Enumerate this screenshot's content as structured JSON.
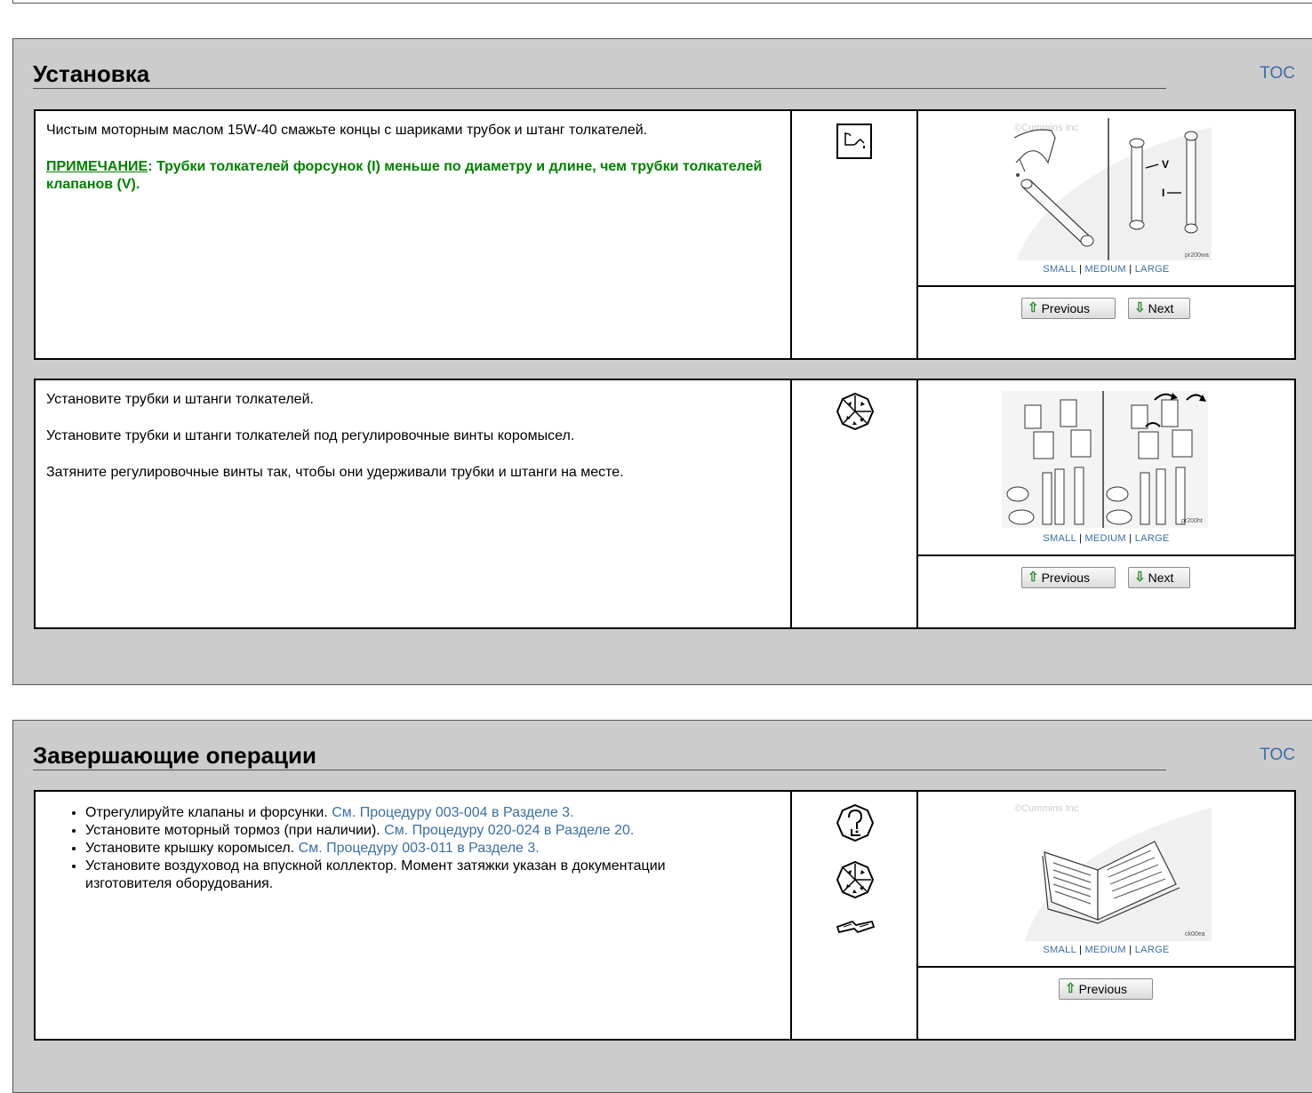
{
  "sections": [
    {
      "title": "Установка",
      "toc": "TOC",
      "steps": [
        {
          "paragraphs": [
            "Чистым моторным маслом 15W-40 смажьте концы с шариками трубок и штанг толкателей."
          ],
          "note_label": "ПРИМЕЧАНИЕ",
          "note_text": ": Трубки толкателей форсунок (I) меньше по диаметру и длине, чем трубки толкателей клапанов (V).",
          "icons": [
            "oil-can-icon"
          ],
          "image": {
            "watermark": "©Cummins Inc",
            "labels": [
              "V",
              "I"
            ],
            "code": "pr200wa"
          },
          "sizes": [
            "SMALL",
            "MEDIUM",
            "LARGE"
          ],
          "buttons": {
            "previous": "Previous",
            "next": "Next"
          }
        },
        {
          "paragraphs": [
            "Установите трубки и штанги толкателей.",
            "Установите трубки и штанги толкателей под регулировочные винты коромысел.",
            "Затяните регулировочные винты так, чтобы они удерживали трубки и штанги на месте."
          ],
          "icons": [
            "install-icon"
          ],
          "image": {
            "code": "pr200ht"
          },
          "sizes": [
            "SMALL",
            "MEDIUM",
            "LARGE"
          ],
          "buttons": {
            "previous": "Previous",
            "next": "Next"
          }
        }
      ]
    },
    {
      "title": "Завершающие операции",
      "toc": "TOC",
      "steps": [
        {
          "bullets": [
            {
              "text": "Отрегулируйте клапаны и форсунки. ",
              "link": "См. Процедуру 003-004 в Разделе 3."
            },
            {
              "text": "Установите моторный тормоз (при наличии). ",
              "link": "См. Процедуру 020-024 в Разделе 20."
            },
            {
              "text": "Установите крышку коромысел. ",
              "link": "См. Процедуру 003-011 в Разделе 3."
            },
            {
              "text": "Установите воздуховод на впускной коллектор. Момент затяжки указан в документации изготовителя оборудования.",
              "link": ""
            }
          ],
          "icons": [
            "reference-icon",
            "install-icon",
            "manual-icon"
          ],
          "image": {
            "watermark": "©Cummins Inc",
            "code": "ck00ea"
          },
          "sizes": [
            "SMALL",
            "MEDIUM",
            "LARGE"
          ],
          "buttons": {
            "previous": "Previous"
          }
        }
      ]
    }
  ]
}
